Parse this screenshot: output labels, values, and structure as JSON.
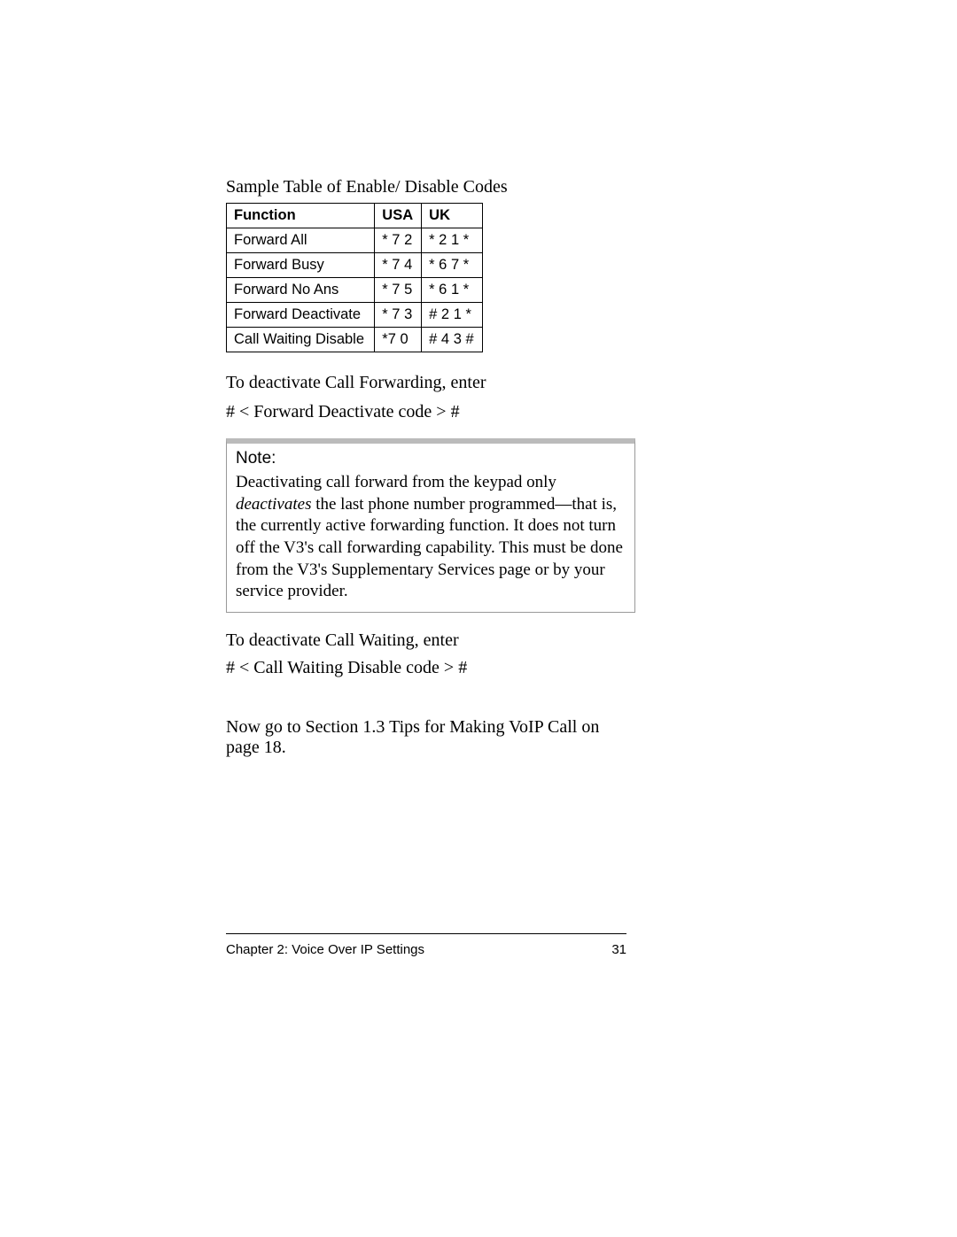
{
  "tableTitle": "Sample Table of Enable/ Disable Codes",
  "headers": {
    "func": "Function",
    "usa": "USA",
    "uk": "UK"
  },
  "rows": [
    {
      "func": "Forward All",
      "usa": "* 7 2",
      "uk": "* 2 1 *"
    },
    {
      "func": "Forward Busy",
      "usa": "* 7 4",
      "uk": "* 6 7 *"
    },
    {
      "func": "Forward No Ans",
      "usa": "* 7 5",
      "uk": "* 6 1 *"
    },
    {
      "func": "Forward Deactivate",
      "usa": "* 7 3",
      "uk": "# 2 1 *"
    },
    {
      "func": "Call Waiting Disable",
      "usa": "*7 0",
      "uk": "# 4 3 #"
    }
  ],
  "p_deact_fwd": "To deactivate Call Forwarding, enter",
  "code_fwd": "#  <  Forward Deactivate code >  #",
  "note_heading": "Note:",
  "note_pre": "Deactivating call forward from the keypad only ",
  "note_em": "deactivates",
  "note_post": " the last phone number programmed—that is, the currently active forwarding function. It does not turn off the V3's call forwarding capability. This must be done from the V3's Supplementary Services page or by your service provider.",
  "p_deact_cw": "To deactivate Call Waiting, enter",
  "code_cw": "#  <  Call Waiting Disable code >  #",
  "goto": "Now go to Section 1.3 Tips for Making VoIP Call on page 18.",
  "footer_left": "Chapter 2: Voice Over IP Settings",
  "footer_right": "31",
  "chart_data": {
    "type": "table",
    "title": "Sample Table of Enable/ Disable Codes",
    "columns": [
      "Function",
      "USA",
      "UK"
    ],
    "rows": [
      [
        "Forward All",
        "* 7 2",
        "* 2 1 *"
      ],
      [
        "Forward Busy",
        "* 7 4",
        "* 6 7 *"
      ],
      [
        "Forward No Ans",
        "* 7 5",
        "* 6 1 *"
      ],
      [
        "Forward Deactivate",
        "* 7 3",
        "# 2 1 *"
      ],
      [
        "Call Waiting Disable",
        "*7 0",
        "# 4 3 #"
      ]
    ]
  }
}
